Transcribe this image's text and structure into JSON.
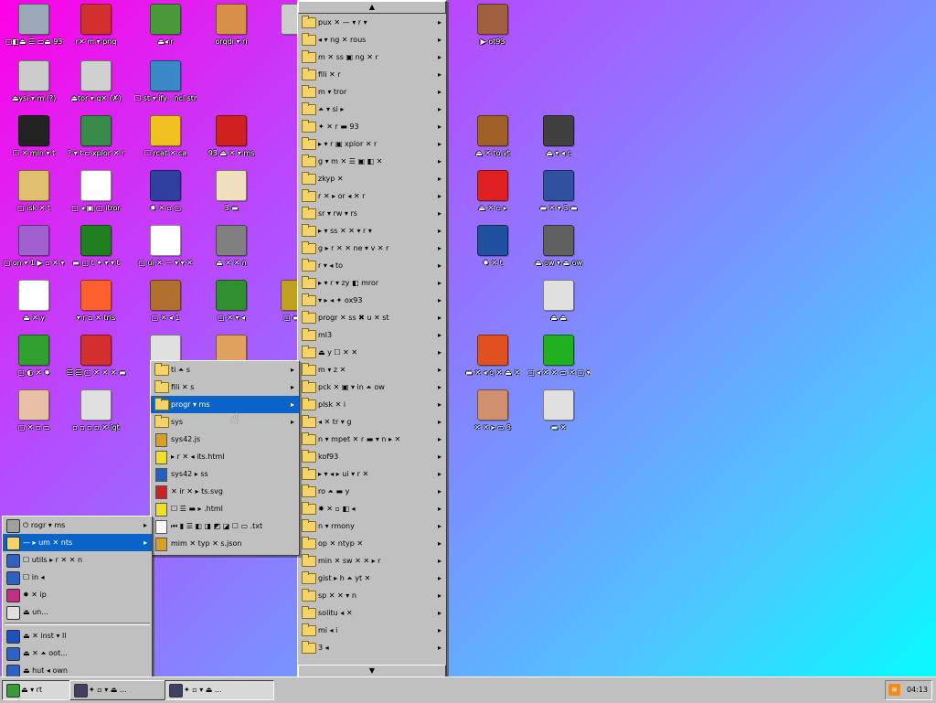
{
  "desktop": {
    "icons": [
      {
        "label": "▢◧⏏ ☰ ▭⏏ 93",
        "color": "#9aa8b8"
      },
      {
        "label": "r✕ m ▾ pnq",
        "color": "#d43030"
      },
      {
        "label": "⏏◂ r",
        "color": "#4a9a3a"
      },
      {
        "label": "orqdi ▾ ri",
        "color": "#d89048"
      },
      {
        "label": "",
        "color": "#cccccc"
      },
      {
        "label": "▶ ot93",
        "color": "#a06040"
      },
      {
        "label": "⏏ysi ▾ m (?)",
        "color": "#cccccc"
      },
      {
        "label": "⏏tor ▾ q✕ (✗)",
        "color": "#d0d0d0"
      },
      {
        "label": "☐ st ▾ ify . ncl stras ▣ rust",
        "color": "#3a88c8"
      },
      {
        "label": "☐ ✕ min ▾ t",
        "color": "#222222"
      },
      {
        "label": "? ▾ t ▫ xplor ✕ r",
        "color": "#3a8a4a"
      },
      {
        "label": "☐ rcat ✕ ca",
        "color": "#f0c020"
      },
      {
        "label": "93 ⏏ ✕ ▾ ms",
        "color": "#d02020"
      },
      {
        "label": "⏏ ✕ to yt",
        "color": "#a06028"
      },
      {
        "label": "⏏ ▾ ◂ c",
        "color": "#404040"
      },
      {
        "label": "▢ isk ✕ t",
        "color": "#e0c070"
      },
      {
        "label": "▢ ◂ ▣ ▢ itror",
        "color": "#ffffff"
      },
      {
        "label": "✸ ✕ ▫ ▢",
        "color": "#3040a0"
      },
      {
        "label": "3 ▬",
        "color": "#f0e0c0"
      },
      {
        "label": "⏏ ✕ ▫ ▸",
        "color": "#e02020"
      },
      {
        "label": "▬ ✕ ▾ 3 ▬",
        "color": "#3050a0"
      },
      {
        "label": "▢ on ▾ 1 ▶ ▫ ✕ ▾",
        "color": "#a060d0"
      },
      {
        "label": "▬ ▢ t ✦ ▾ ▾ t",
        "color": "#208020"
      },
      {
        "label": "▢ ui ✕ — ▾ ▾ ✕",
        "color": "#ffffff"
      },
      {
        "label": "⏏ ✕ ✕ n",
        "color": "#808080"
      },
      {
        "label": "✸ ✕ t",
        "color": "#2050a0"
      },
      {
        "label": "⏏ ow ▾ ⏏ ow",
        "color": "#606060"
      },
      {
        "label": "⏏ ✕ y",
        "color": "#ffffff"
      },
      {
        "label": "▾ r ▫ ✕ tris",
        "color": "#ff6030"
      },
      {
        "label": "▢ ✕ ◂ 1",
        "color": "#b07030"
      },
      {
        "label": "▢ ✕ ▾ ◂",
        "color": "#309030"
      },
      {
        "label": "▢ ▬ ▭",
        "color": "#c0a020"
      },
      {
        "label": "⏏ ⏏",
        "color": "#e0e0e0"
      },
      {
        "label": "▢ ◐ ✕ ✸",
        "color": "#30a030"
      },
      {
        "label": "☰ ☰ ▢ ✕ ✕ ✕ ▬",
        "color": "#d43030"
      },
      {
        "label": "⏏ ✕",
        "color": "#e0e0e0"
      },
      {
        "label": "▬ ◐ ✕ ▭",
        "color": "#e0a060"
      },
      {
        "label": "▬ ✕ ◂ q ✕ ⏏ ✕",
        "color": "#e05020"
      },
      {
        "label": "▢ ◂ ✕ ✕ ▭ ✕ ▢ ▾",
        "color": "#20b020"
      },
      {
        "label": "▢ ✕ ▫ ▭",
        "color": "#e8c0a8"
      },
      {
        "label": "▫ ▫ ▫ ▫ ✕ igt",
        "color": "#e0e0e0"
      },
      {
        "label": "✕ ✕ ▸ ▭ 3",
        "color": "#d09070"
      },
      {
        "label": "▬ ✕",
        "color": "#e0e0e0"
      }
    ]
  },
  "bigmenu": {
    "items": [
      {
        "label": "pux ✕ — ▾ r ▾"
      },
      {
        "label": "◂ ▾ ng ✕ rous"
      },
      {
        "label": "m ✕ ss ▣ ng ✕ r"
      },
      {
        "label": "fili ✕ r"
      },
      {
        "label": "m ▾ tror"
      },
      {
        "label": "⏶ ▾ si ▸"
      },
      {
        "label": "✦ ✕ r ▬ 93"
      },
      {
        "label": "▸ ▾ r ▣ xplor ✕ r"
      },
      {
        "label": "g ▾ m ✕ ☰ ▣ ◧ ✕"
      },
      {
        "label": "zkyp ✕"
      },
      {
        "label": "r ✕ ▸ or ◂ ✕ r"
      },
      {
        "label": "sr ▾ rw ▾ rs"
      },
      {
        "label": "▸ ▾ ss ✕ ✕ ▾ r ▾"
      },
      {
        "label": "g ▸ r ✕ ✕ ne ▾ v ✕ r"
      },
      {
        "label": "r ▾ ◂ to"
      },
      {
        "label": "▸ ▾ r ▾ zy ◧ mror"
      },
      {
        "label": "▾ ▸ ◂ ✦ ox93"
      },
      {
        "label": "progr ✕ ss ✖ u ✕ st"
      },
      {
        "label": "ml3"
      },
      {
        "label": "⏏ y ☐ ✕ ✕"
      },
      {
        "label": "m ▾ z ✕"
      },
      {
        "label": "pck ✕ ▣ ▾ in ⏶ ow"
      },
      {
        "label": "plsk ✕ i"
      },
      {
        "label": "◂ ✕ tr ▾ g"
      },
      {
        "label": "n ▾ mpet ✕ r ▬ ▾ n ▸ ✕"
      },
      {
        "label": "kof93"
      },
      {
        "label": "▸ ▾ ◂ ▸ ui ▾ r ✕"
      },
      {
        "label": "ro ⏶ ▬ y"
      },
      {
        "label": "✸ ✕ ▫ ◧ ◂"
      },
      {
        "label": "n ▾ rmony"
      },
      {
        "label": "op ✕ ntyp ✕"
      },
      {
        "label": "min ✕ sw ✕ ✕ ▸ r"
      },
      {
        "label": "gist ▸ h ⏶ yt ✕"
      },
      {
        "label": "sp ✕ ✕ ▾ n"
      },
      {
        "label": "solitu ◂ ✕"
      },
      {
        "label": "mi ◂ i"
      },
      {
        "label": "3 ◂"
      }
    ]
  },
  "submenu": {
    "items": [
      {
        "label": "ti ⏶ s",
        "kind": "folder",
        "arrow": true
      },
      {
        "label": "fili ✕ s",
        "kind": "folder",
        "arrow": true
      },
      {
        "label": "progr ▾ ms",
        "kind": "folder",
        "arrow": true,
        "selected": true
      },
      {
        "label": "sys",
        "kind": "folder",
        "arrow": true
      },
      {
        "label": "sys42.js",
        "kind": "file",
        "color": "#d8a020"
      },
      {
        "label": "▸ r ✕ ◂ its.html",
        "kind": "file",
        "color": "#f0e020"
      },
      {
        "label": "sys42 ▸ ss",
        "kind": "file",
        "color": "#2060c0"
      },
      {
        "label": "✕ ir ✕ ▸ ts.svg",
        "kind": "file",
        "color": "#d02020"
      },
      {
        "label": "☐ ☰ ▬ ▸ .html",
        "kind": "file",
        "color": "#f0e020"
      },
      {
        "label": "⏮ ▮ ☰ ◧ ◨ ◩ ◪ ☐ ▭ .txt",
        "kind": "file",
        "color": "#ffffff"
      },
      {
        "label": "mim ✕ typ ✕ s.json",
        "kind": "file",
        "color": "#d8a020"
      }
    ]
  },
  "startmenu": {
    "items": [
      {
        "label": "⏻ rogr ▾ ms",
        "arrow": true,
        "color": "#a0a0a0"
      },
      {
        "label": "— ▸ um ✕ nts",
        "arrow": true,
        "selected": true,
        "color": "#f3d36b"
      },
      {
        "label": "☐ utils ▸ r ✕ ✕ n",
        "color": "#3060c0"
      },
      {
        "label": "☐ in ◂",
        "color": "#3060c0"
      },
      {
        "label": "✸ ✕ ip",
        "color": "#c03080"
      },
      {
        "label": "⏏ un...",
        "color": "#e0e0e0"
      },
      {
        "label": "⏏ ✕ inst ▾ ll",
        "color": "#2050c0",
        "sep_before": true
      },
      {
        "label": "⏏ ✕ ⏶ oot...",
        "color": "#3060c0"
      },
      {
        "label": "⏏ hut ◂ own",
        "color": "#3060c0"
      }
    ]
  },
  "taskbar": {
    "start_label": "⏏ ▾ rt",
    "tasks": [
      {
        "label": "✦ ▫ ▾ ⏏ ..."
      },
      {
        "label": "✦ ▫ ▾ ⏏ ...",
        "pressed": true
      }
    ],
    "tray_icon": "rss-icon",
    "clock": "04:13"
  }
}
